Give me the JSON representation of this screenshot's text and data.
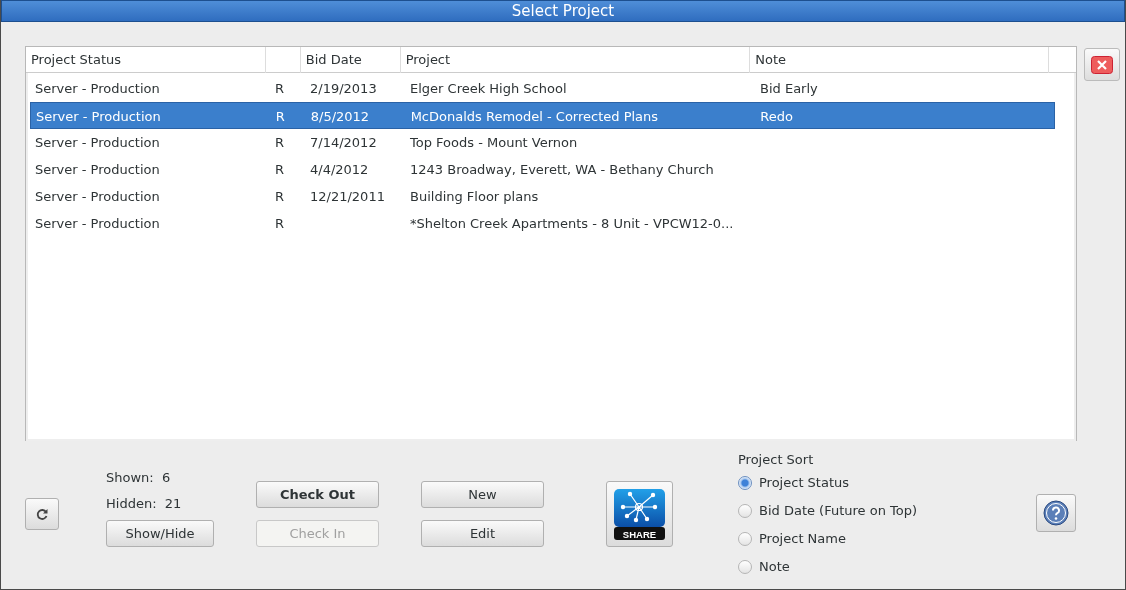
{
  "window": {
    "title": "Select Project"
  },
  "table": {
    "columns": [
      "Project Status",
      null,
      "Bid Date",
      "Project",
      "Note"
    ],
    "rows": [
      {
        "cells": [
          "Server - Production",
          "R",
          "2/19/2013",
          "Elger Creek High School",
          "Bid Early"
        ],
        "selected": false
      },
      {
        "cells": [
          "Server - Production",
          "R",
          "8/5/2012",
          "McDonalds Remodel - Corrected Plans",
          "Redo"
        ],
        "selected": true
      },
      {
        "cells": [
          "Server - Production",
          "R",
          "7/14/2012",
          "Top Foods - Mount Vernon",
          null
        ],
        "selected": false
      },
      {
        "cells": [
          "Server - Production",
          "R",
          "4/4/2012",
          "1243 Broadway, Everett, WA - Bethany Church",
          null
        ],
        "selected": false
      },
      {
        "cells": [
          "Server - Production",
          "R",
          "12/21/2011",
          "Building Floor plans",
          null
        ],
        "selected": false
      },
      {
        "cells": [
          "Server - Production",
          "R",
          null,
          "*Shelton Creek Apartments - 8 Unit - VPCW12-0...",
          null
        ],
        "selected": false
      }
    ]
  },
  "counts": {
    "shown_label": "Shown:",
    "shown": "6",
    "hidden_label": "Hidden:",
    "hidden": "21"
  },
  "buttons": [
    {
      "label": "Show/Hide",
      "default": false,
      "disabled": false
    },
    {
      "label": "Check Out",
      "default": true,
      "disabled": false
    },
    {
      "label": "Check In",
      "default": false,
      "disabled": true
    },
    {
      "label": "New",
      "default": false,
      "disabled": false
    },
    {
      "label": "Edit",
      "default": false,
      "disabled": false
    }
  ],
  "share_button": {
    "label": "SHARE"
  },
  "sort": {
    "title": "Project Sort",
    "options": [
      {
        "label": "Project Status",
        "selected": true
      },
      {
        "label": "Bid Date (Future on Top)",
        "selected": false
      },
      {
        "label": "Project Name",
        "selected": false
      },
      {
        "label": "Note",
        "selected": false
      }
    ]
  }
}
